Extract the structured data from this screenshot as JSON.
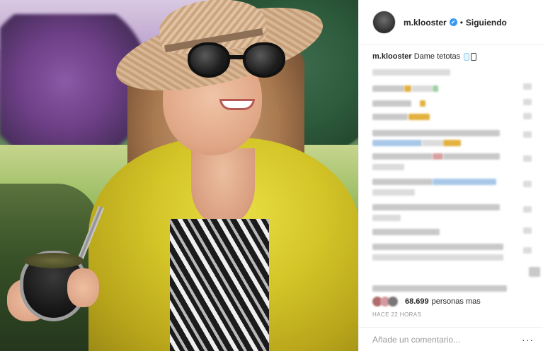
{
  "post": {
    "username": "m.klooster",
    "follow_status": "Siguiendo",
    "separator": "•",
    "verified_glyph": "✔"
  },
  "caption": {
    "username": "m.klooster",
    "text": "Dame tetotas"
  },
  "likes": {
    "count": "68.699",
    "label": "personas mas"
  },
  "timestamp": "HACE 22 HORAS",
  "comment_input": {
    "placeholder": "Añade un comentario..."
  },
  "menu_glyph": "···",
  "colors": {
    "verified_blue": "#3897f0",
    "border": "#efefef",
    "muted_text": "#999999"
  },
  "icons": [
    "verified-icon",
    "more-options-icon"
  ]
}
